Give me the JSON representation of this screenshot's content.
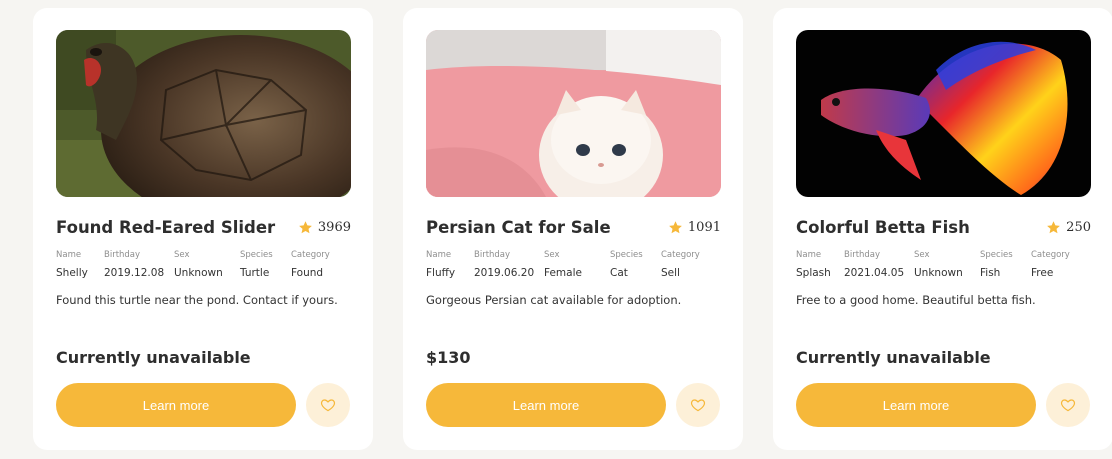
{
  "colors": {
    "accent": "#f6b83a",
    "accent_light": "#fdf0d8",
    "star": "#f6b83a"
  },
  "labels": {
    "name": "Name",
    "birthday": "Birthday",
    "sex": "Sex",
    "species": "Species",
    "category": "Category"
  },
  "cards": [
    {
      "image": "red-eared-slider-turtle-photo",
      "title": "Found Red-Eared Slider",
      "rating": "3969",
      "name": "Shelly",
      "birthday": "2019.12.08",
      "sex": "Unknown",
      "species": "Turtle",
      "category": "Found",
      "description": "Found this turtle near the pond. Contact if yours.",
      "price": "Currently unavailable",
      "button_label": "Learn more",
      "favorite_icon": "heart-icon"
    },
    {
      "image": "persian-kitten-photo",
      "title": "Persian Cat for Sale",
      "rating": "1091",
      "name": "Fluffy",
      "birthday": "2019.06.20",
      "sex": "Female",
      "species": "Cat",
      "category": "Sell",
      "description": "Gorgeous Persian cat available for adoption.",
      "price": "$130",
      "button_label": "Learn more",
      "favorite_icon": "heart-icon"
    },
    {
      "image": "betta-fish-photo",
      "title": "Colorful Betta Fish",
      "rating": "250",
      "name": "Splash",
      "birthday": "2021.04.05",
      "sex": "Unknown",
      "species": "Fish",
      "category": "Free",
      "description": "Free to a good home. Beautiful betta fish.",
      "price": "Currently unavailable",
      "button_label": "Learn more",
      "favorite_icon": "heart-icon"
    }
  ]
}
